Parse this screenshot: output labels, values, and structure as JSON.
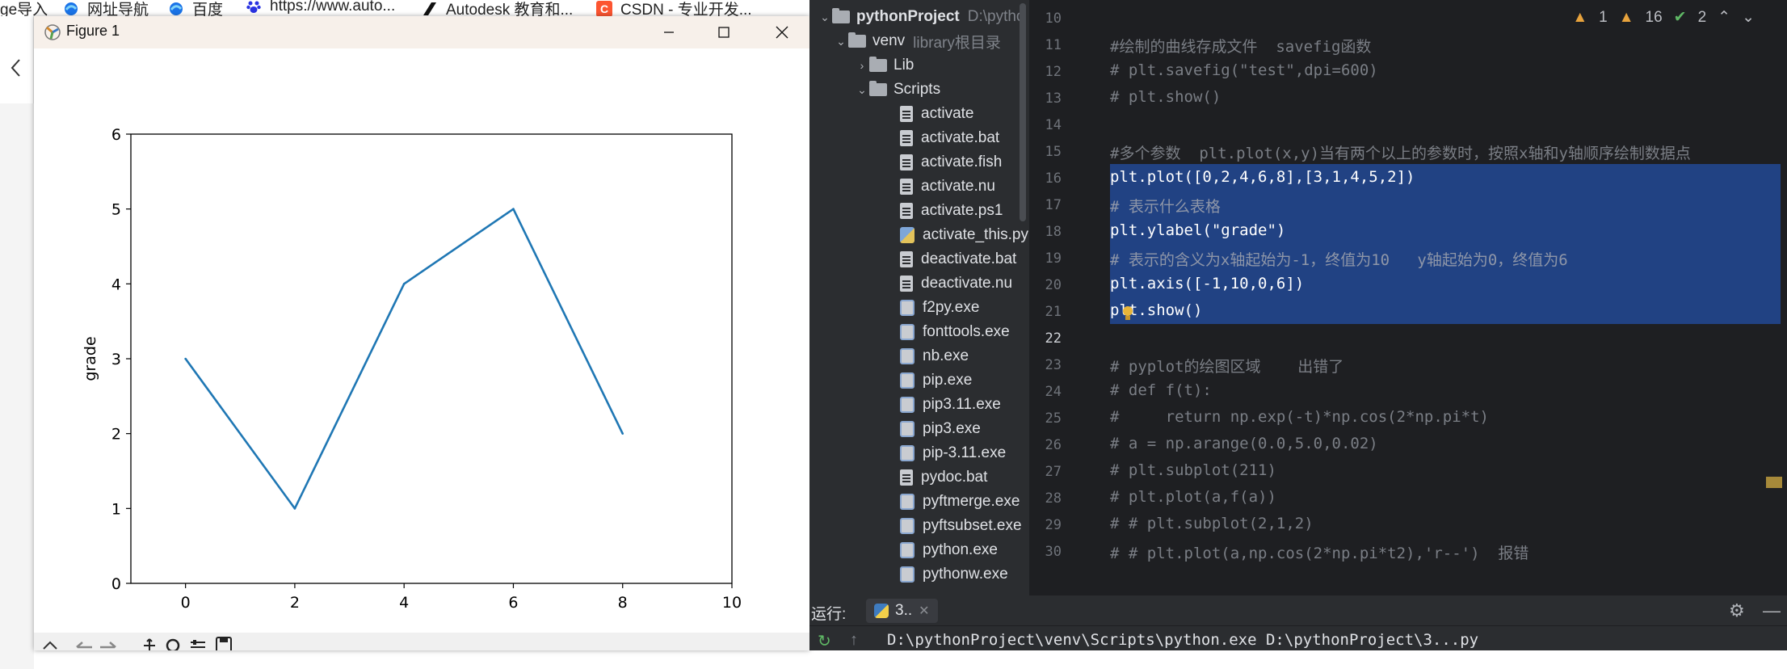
{
  "browser": {
    "bookmarks": [
      {
        "label": "ge导入",
        "icon": "folder-icon"
      },
      {
        "label": "网址导航",
        "icon": "edge-icon"
      },
      {
        "label": "百度",
        "icon": "edge-icon"
      },
      {
        "label": "https://www.auto...",
        "icon": "baidu-paw-icon"
      },
      {
        "label": "Autodesk 教育和...",
        "icon": "autodesk-icon"
      },
      {
        "label": "CSDN - 专业开发...",
        "icon": "csdn-icon"
      }
    ]
  },
  "figure": {
    "title": "Figure 1",
    "chart_data": {
      "type": "line",
      "x": [
        0,
        2,
        4,
        6,
        8
      ],
      "y": [
        3,
        1,
        4,
        5,
        2
      ],
      "ylabel": "grade",
      "xlabel": "",
      "xlim": [
        -1,
        10
      ],
      "ylim": [
        0,
        6
      ],
      "xticks": [
        "0",
        "2",
        "4",
        "6",
        "8",
        "10"
      ],
      "yticks": [
        "0",
        "1",
        "2",
        "3",
        "4",
        "5",
        "6"
      ],
      "line_color": "#1f77b4",
      "grid": false
    }
  },
  "project": {
    "root_name": "pythonProject",
    "root_path": "D:\\pytho",
    "venv": "venv",
    "venv_hint": "library根目录",
    "lib": "Lib",
    "scripts": "Scripts",
    "files": [
      {
        "name": "activate",
        "kind": "file"
      },
      {
        "name": "activate.bat",
        "kind": "file"
      },
      {
        "name": "activate.fish",
        "kind": "file"
      },
      {
        "name": "activate.nu",
        "kind": "file"
      },
      {
        "name": "activate.ps1",
        "kind": "file"
      },
      {
        "name": "activate_this.py",
        "kind": "py"
      },
      {
        "name": "deactivate.bat",
        "kind": "file"
      },
      {
        "name": "deactivate.nu",
        "kind": "file"
      },
      {
        "name": "f2py.exe",
        "kind": "exe"
      },
      {
        "name": "fonttools.exe",
        "kind": "exe"
      },
      {
        "name": "nb.exe",
        "kind": "exe"
      },
      {
        "name": "pip.exe",
        "kind": "exe"
      },
      {
        "name": "pip3.11.exe",
        "kind": "exe"
      },
      {
        "name": "pip3.exe",
        "kind": "exe"
      },
      {
        "name": "pip-3.11.exe",
        "kind": "exe"
      },
      {
        "name": "pydoc.bat",
        "kind": "file"
      },
      {
        "name": "pyftmerge.exe",
        "kind": "exe"
      },
      {
        "name": "pyftsubset.exe",
        "kind": "exe"
      },
      {
        "name": "python.exe",
        "kind": "exe"
      },
      {
        "name": "pythonw.exe",
        "kind": "exe"
      }
    ]
  },
  "editor": {
    "inspections": {
      "warnings_a": "1",
      "warnings_b": "16",
      "ok": "2"
    },
    "lines": [
      {
        "n": "10",
        "text": ""
      },
      {
        "n": "11",
        "text": "#绘制的曲线存成文件  savefig函数"
      },
      {
        "n": "12",
        "text": "# plt.savefig(\"test\",dpi=600)"
      },
      {
        "n": "13",
        "text": "# plt.show()"
      },
      {
        "n": "14",
        "text": ""
      },
      {
        "n": "15",
        "text": "#多个参数  plt.plot(x,y)当有两个以上的参数时，按照x轴和y轴顺序绘制数据点"
      },
      {
        "n": "16",
        "text": "plt.plot([0,2,4,6,8],[3,1,4,5,2])"
      },
      {
        "n": "17",
        "text": "# 表示什么表格"
      },
      {
        "n": "18",
        "text": "plt.ylabel(\"grade\")"
      },
      {
        "n": "19",
        "text": "# 表示的含义为x轴起始为-1，终值为10   y轴起始为0，终值为6"
      },
      {
        "n": "20",
        "text": "plt.axis([-1,10,0,6])"
      },
      {
        "n": "21",
        "text": "plt.show()"
      },
      {
        "n": "22",
        "text": ""
      },
      {
        "n": "23",
        "text": "# pyplot的绘图区域    出错了"
      },
      {
        "n": "24",
        "text": "# def f(t):"
      },
      {
        "n": "25",
        "text": "#     return np.exp(-t)*np.cos(2*np.pi*t)"
      },
      {
        "n": "26",
        "text": "# a = np.arange(0.0,5.0,0.02)"
      },
      {
        "n": "27",
        "text": "# plt.subplot(211)"
      },
      {
        "n": "28",
        "text": "# plt.plot(a,f(a))"
      },
      {
        "n": "29",
        "text": "# # plt.subplot(2,1,2)"
      },
      {
        "n": "30",
        "text": "# # plt.plot(a,np.cos(2*np.pi*t2),'r--')  报错"
      }
    ]
  },
  "run": {
    "label": "运行:",
    "tab": "3..",
    "output": "D:\\pythonProject\\venv\\Scripts\\python.exe D:\\pythonProject\\3...py"
  },
  "colors": {
    "editor_bg": "#1e1f22",
    "panel_bg": "#2b2d30",
    "selection": "#214283",
    "plot_line": "#1f77b4"
  }
}
